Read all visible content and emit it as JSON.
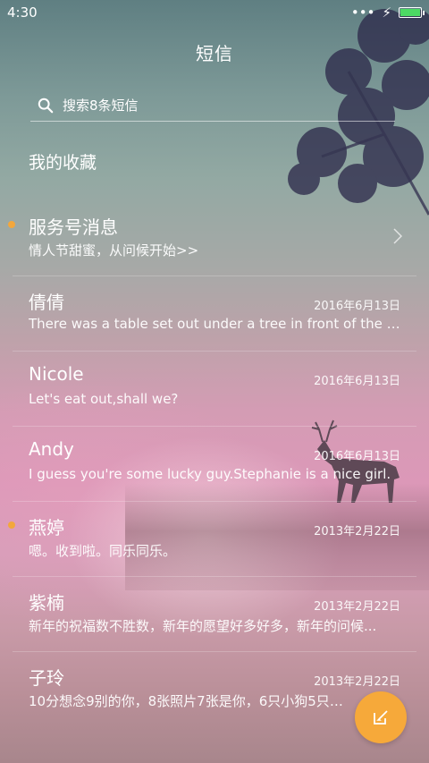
{
  "status": {
    "time": "4:30",
    "battery_level": 1.0,
    "battery_color": "#4cd964"
  },
  "header": {
    "title": "短信"
  },
  "search": {
    "placeholder": "搜索8条短信"
  },
  "favorites": {
    "label": "我的收藏"
  },
  "messages": [
    {
      "name": "服务号消息",
      "preview": "情人节甜蜜，从问候开始>>",
      "date": "",
      "unread": true,
      "chevron": true
    },
    {
      "name": "倩倩",
      "preview": "There was a table set out under a tree in front of the ho...",
      "date": "2016年6月13日",
      "unread": false
    },
    {
      "name": "Nicole",
      "preview": "Let's eat out,shall we?",
      "date": "2016年6月13日",
      "unread": false
    },
    {
      "name": "Andy",
      "preview": "I guess you're some lucky guy.Stephanie is a nice girl.",
      "date": "2016年6月13日",
      "unread": false
    },
    {
      "name": "燕婷",
      "preview": "嗯。收到啦。同乐同乐。",
      "date": "2013年2月22日",
      "unread": true
    },
    {
      "name": "紫楠",
      "preview": "新年的祝福数不胜数，新年的愿望好多好多，新年的问候...",
      "date": "2013年2月22日",
      "unread": false
    },
    {
      "name": "子玲",
      "preview": "10分想念9别的你，8张照片7张是你，6只小狗5只像你...",
      "date": "2013年2月22日",
      "unread": false
    }
  ],
  "colors": {
    "unread_dot": "#f3a73c",
    "compose_button": "#f6a93a"
  },
  "icons": {
    "search": "search-icon",
    "compose": "compose-icon",
    "chevron": "chevron-right-icon"
  }
}
